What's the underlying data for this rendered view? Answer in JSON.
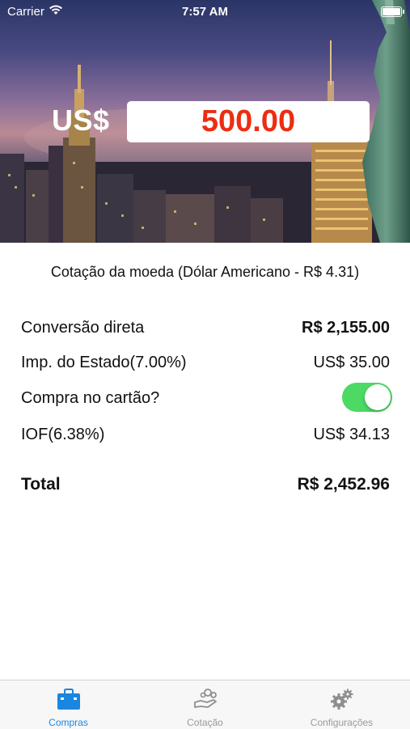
{
  "status_bar": {
    "carrier": "Carrier",
    "time": "7:57 AM"
  },
  "hero": {
    "currency_label": "US$",
    "amount_value": "500.00",
    "amount_color": "#ec2d12"
  },
  "quote": {
    "rate_text": "Cotação da moeda (Dólar Americano - R$ 4.31)"
  },
  "rows": {
    "direct": {
      "label": "Conversão direta",
      "value": "R$ 2,155.00"
    },
    "state_tax": {
      "label": "Imp. do Estado(7.00%)",
      "value": "US$ 35.00"
    },
    "card": {
      "label": "Compra no cartão?",
      "toggle_on": true
    },
    "iof": {
      "label": "IOF(6.38%)",
      "value": "US$ 34.13"
    },
    "total": {
      "label": "Total",
      "value": "R$ 2,452.96"
    }
  },
  "tabs": [
    {
      "label": "Compras",
      "icon": "briefcase-icon",
      "active": true
    },
    {
      "label": "Cotação",
      "icon": "money-hand-icon",
      "active": false
    },
    {
      "label": "Configurações",
      "icon": "gears-icon",
      "active": false
    }
  ],
  "colors": {
    "accent": "#1a86e0",
    "toggle_on": "#4cd964",
    "amount": "#ec2d12"
  }
}
